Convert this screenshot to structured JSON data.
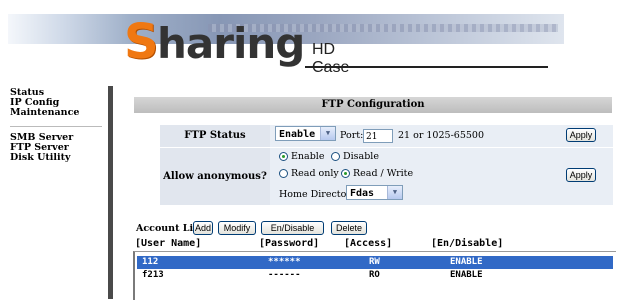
{
  "header": {
    "logo_initial": "S",
    "logo_rest": "haring",
    "logo_subtitle": "HD Case"
  },
  "sidebar": {
    "groups": [
      [
        "Status",
        "IP Config",
        "Maintenance"
      ],
      [
        "SMB Server",
        "FTP Server",
        "Disk Utility"
      ]
    ]
  },
  "ftp": {
    "title": "FTP Configuration",
    "status_label": "FTP Status",
    "status_value": "Enable",
    "port_label": "Port:",
    "port_value": "21",
    "port_hint": "21 or 1025-65500",
    "apply_label": "Apply",
    "anon_label": "Allow anonymous?",
    "anon_enable": "Enable",
    "anon_disable": "Disable",
    "anon_selected": "Enable",
    "read_only": "Read only",
    "read_write": "Read / Write",
    "access_selected": "Read / Write",
    "home_dir_label": "Home Directory:",
    "home_dir_value": "Fdas"
  },
  "accounts": {
    "label": "Account List",
    "buttons": {
      "add": "Add",
      "modify": "Modify",
      "endisable": "En/Disable",
      "delete": "Delete"
    },
    "columns": [
      "[User Name]",
      "[Password]",
      "[Access]",
      "[En/Disable]"
    ],
    "rows": [
      {
        "user": "112",
        "password": "******",
        "access": "RW",
        "state": "ENABLE",
        "selected": true
      },
      {
        "user": "f213",
        "password": "------",
        "access": "RO",
        "state": "ENABLE",
        "selected": false
      }
    ]
  },
  "colors": {
    "accent_orange": "#f07812",
    "selection_blue": "#3169c6"
  }
}
